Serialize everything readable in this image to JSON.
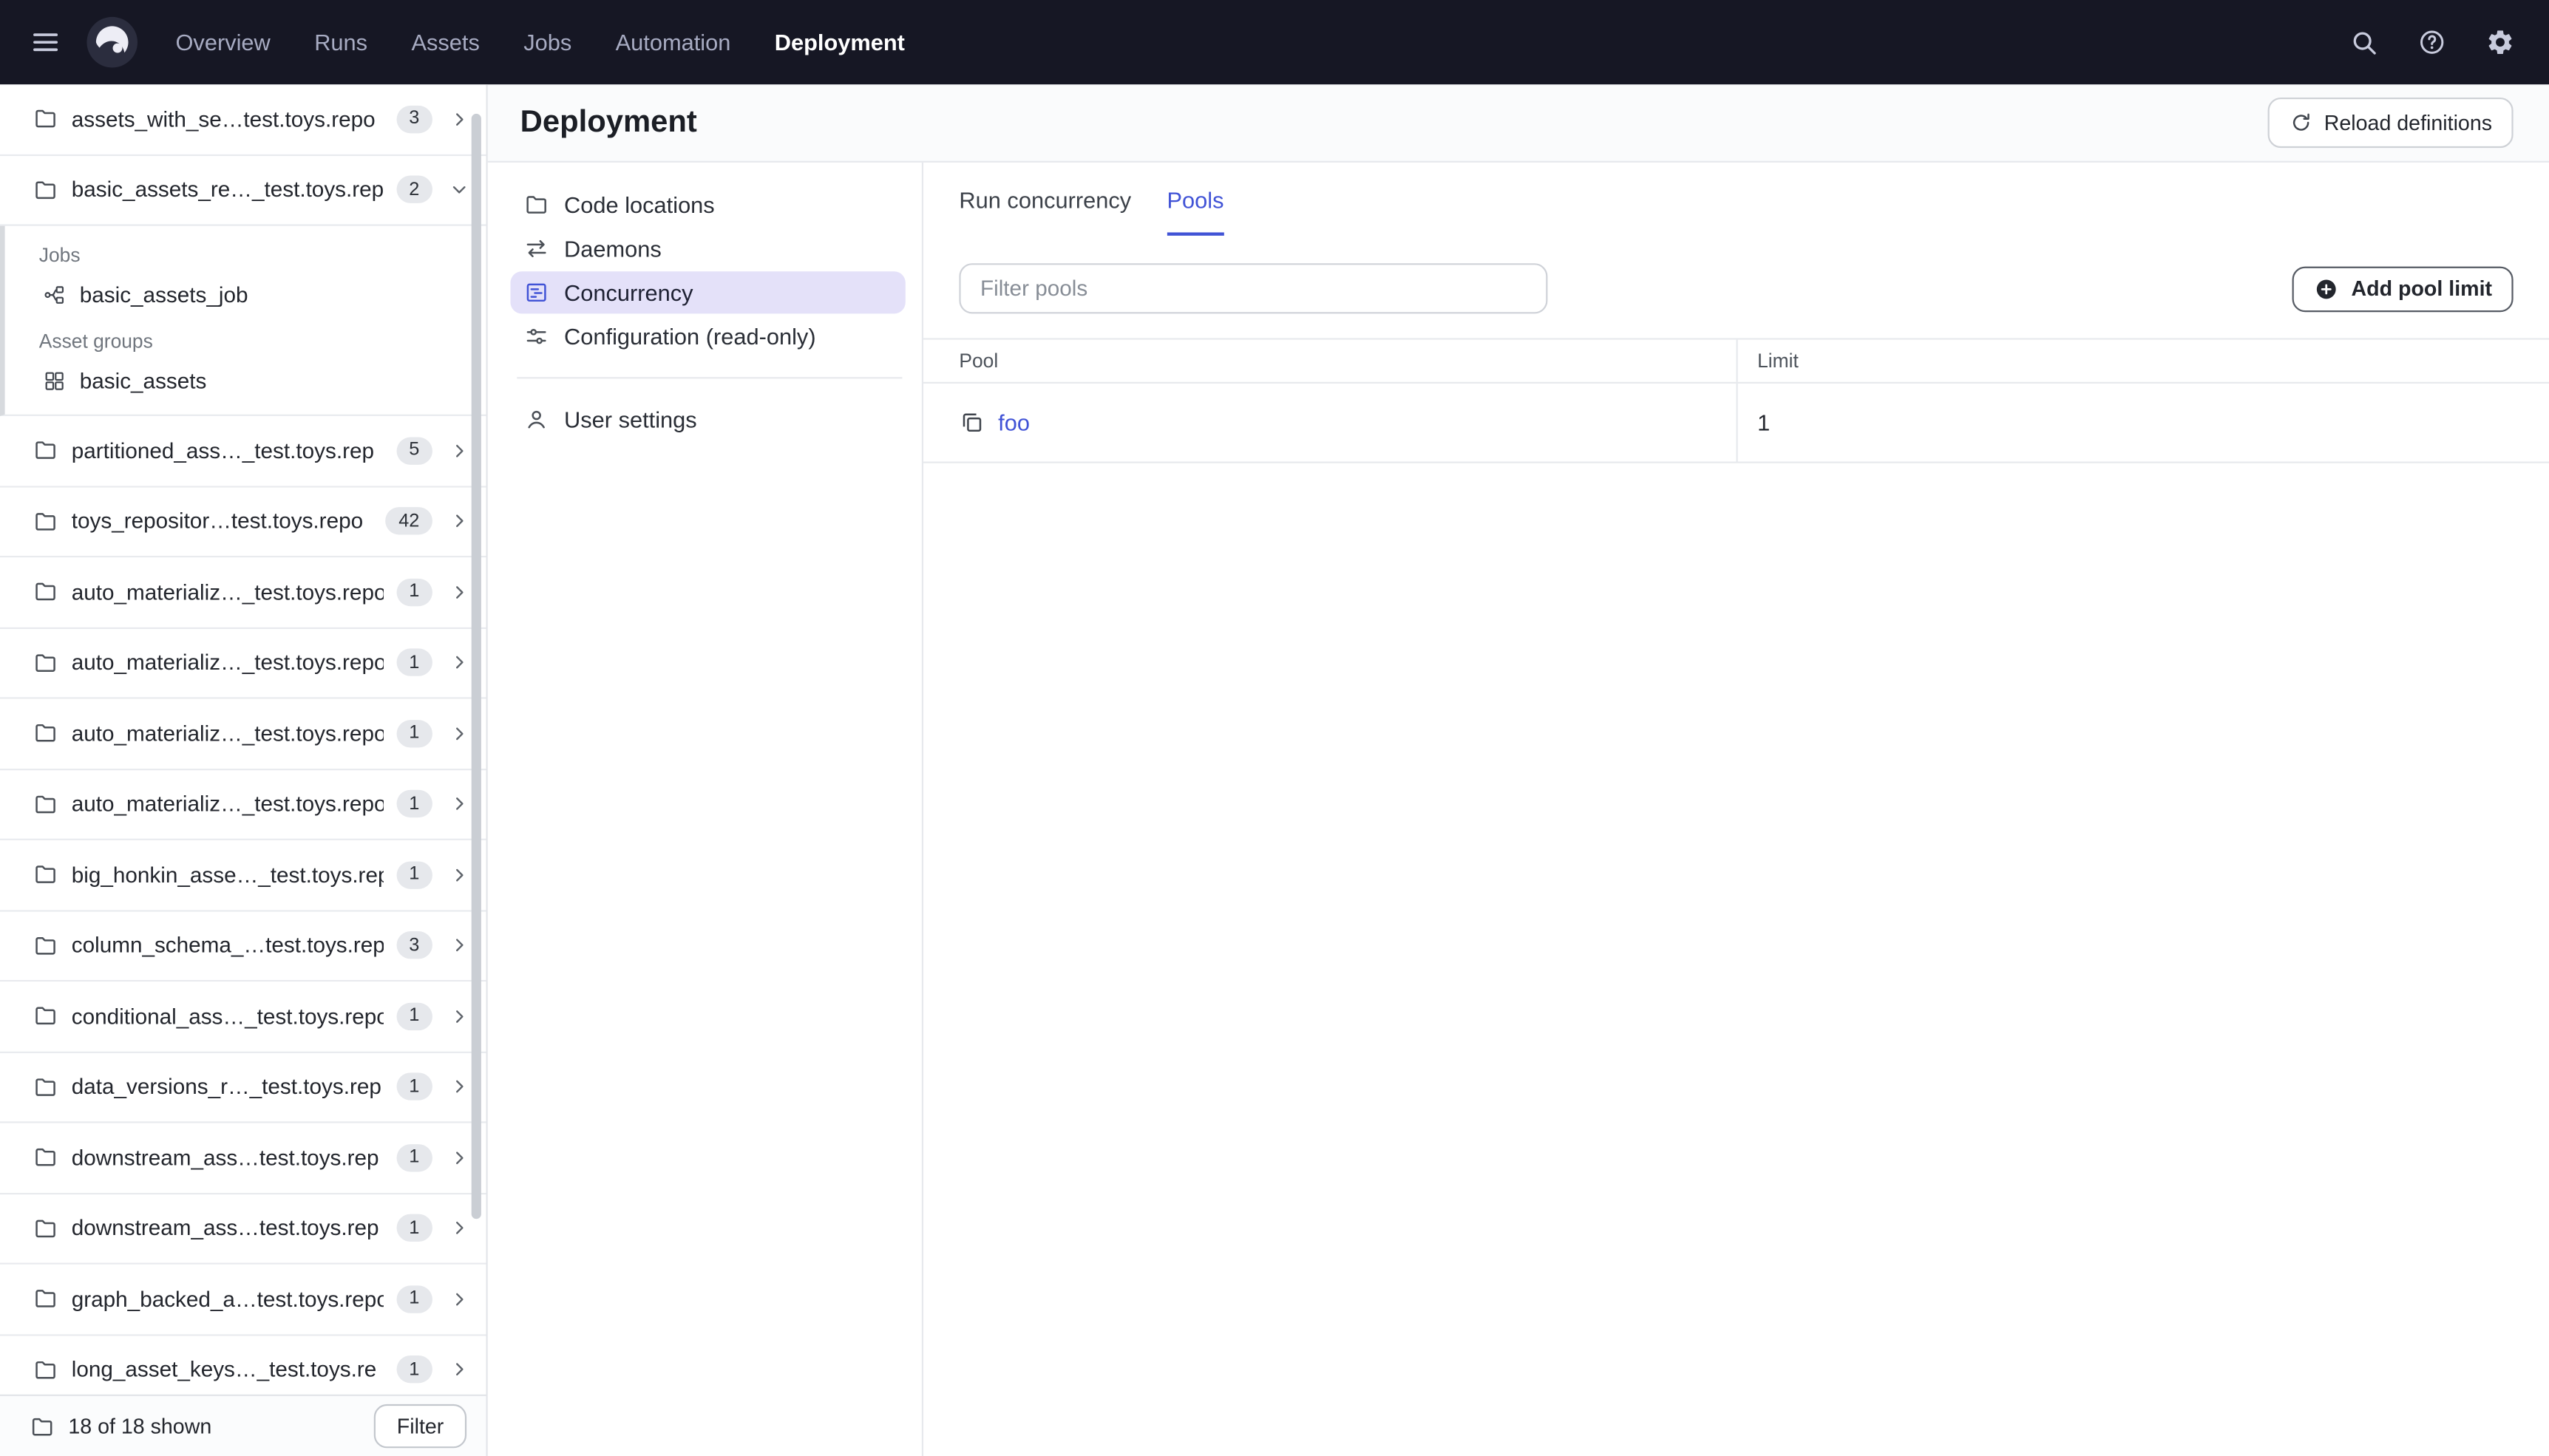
{
  "colors": {
    "accent": "#4153d6",
    "topnav_bg": "#161724",
    "active_nav_bg": "#e4e1f9"
  },
  "topnav": {
    "items": [
      "Overview",
      "Runs",
      "Assets",
      "Jobs",
      "Automation",
      "Deployment"
    ],
    "active_item": "Deployment",
    "menu_icon": "menu-icon",
    "logo_icon": "dagster-logo",
    "icon_buttons": [
      {
        "name": "search",
        "icon": "search"
      },
      {
        "name": "help",
        "icon": "help"
      },
      {
        "name": "settings",
        "icon": "gear"
      }
    ]
  },
  "sidebar": {
    "repos": [
      {
        "label": "assets_with_se…test.toys.repo",
        "count": "3",
        "expanded": false
      },
      {
        "label": "basic_assets_re…_test.toys.rep",
        "count": "2",
        "expanded": true,
        "sections": [
          {
            "title": "Jobs",
            "items": [
              {
                "label": "basic_assets_job",
                "icon": "job"
              }
            ]
          },
          {
            "title": "Asset groups",
            "items": [
              {
                "label": "basic_assets",
                "icon": "asset-group"
              }
            ]
          }
        ]
      },
      {
        "label": "partitioned_ass…_test.toys.rep",
        "count": "5",
        "expanded": false
      },
      {
        "label": "toys_repositor…test.toys.repo",
        "count": "42",
        "expanded": false
      },
      {
        "label": "auto_materializ…_test.toys.repo",
        "count": "1",
        "expanded": false
      },
      {
        "label": "auto_materializ…_test.toys.repo",
        "count": "1",
        "expanded": false
      },
      {
        "label": "auto_materializ…_test.toys.repo",
        "count": "1",
        "expanded": false
      },
      {
        "label": "auto_materializ…_test.toys.repo",
        "count": "1",
        "expanded": false
      },
      {
        "label": "big_honkin_asse…_test.toys.rep",
        "count": "1",
        "expanded": false
      },
      {
        "label": "column_schema_…test.toys.rep",
        "count": "3",
        "expanded": false
      },
      {
        "label": "conditional_ass…_test.toys.repo",
        "count": "1",
        "expanded": false
      },
      {
        "label": "data_versions_r…_test.toys.rep",
        "count": "1",
        "expanded": false
      },
      {
        "label": "downstream_ass…test.toys.rep",
        "count": "1",
        "expanded": false
      },
      {
        "label": "downstream_ass…test.toys.rep",
        "count": "1",
        "expanded": false
      },
      {
        "label": "graph_backed_a…test.toys.repo",
        "count": "1",
        "expanded": false
      },
      {
        "label": "long_asset_keys…_test.toys.re",
        "count": "1",
        "expanded": false
      }
    ],
    "footer": {
      "shown_text": "18 of 18 shown",
      "filter_button": "Filter"
    }
  },
  "deployment": {
    "title": "Deployment",
    "reload_button": "Reload definitions",
    "nav": [
      {
        "label": "Code locations",
        "icon": "folder",
        "active": false
      },
      {
        "label": "Daemons",
        "icon": "daemons",
        "active": false
      },
      {
        "label": "Concurrency",
        "icon": "concurrency",
        "active": true
      },
      {
        "label": "Configuration (read-only)",
        "icon": "sliders",
        "active": false
      }
    ],
    "nav_footer": [
      {
        "label": "User settings",
        "icon": "user",
        "active": false
      }
    ],
    "tabs": [
      {
        "label": "Run concurrency",
        "active": false
      },
      {
        "label": "Pools",
        "active": true
      }
    ],
    "pools": {
      "filter_placeholder": "Filter pools",
      "add_button": "Add pool limit",
      "table": {
        "columns": [
          "Pool",
          "Limit"
        ],
        "rows": [
          {
            "pool": "foo",
            "limit": "1"
          }
        ]
      }
    }
  }
}
